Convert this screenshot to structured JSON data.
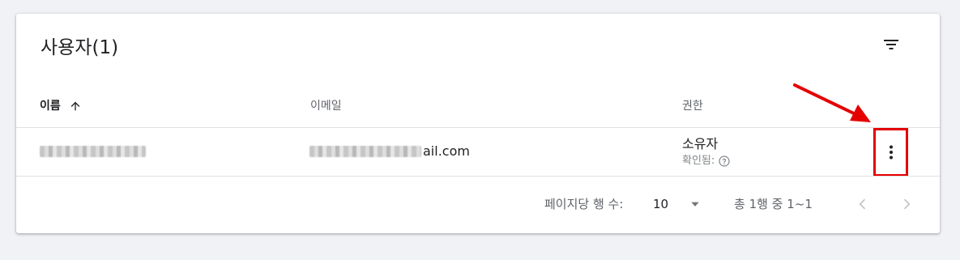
{
  "header": {
    "title": "사용자(1)"
  },
  "table": {
    "columns": {
      "name": "이름",
      "email": "이메일",
      "role": "권한"
    },
    "rows": [
      {
        "email_visible": "ail.com",
        "role": "소유자",
        "status": "확인됨:"
      }
    ]
  },
  "footer": {
    "rows_per_page_label": "페이지당 행 수:",
    "rows_per_page_value": "10",
    "range_text": "총 1행 중 1~1"
  },
  "icons": {
    "filter": "filter-icon",
    "sort": "arrow-up-icon",
    "more": "more-vert-icon",
    "help": "help-circle-icon",
    "dropdown": "caret-down-icon",
    "prev": "chevron-left-icon",
    "next": "chevron-right-icon"
  },
  "colors": {
    "annotation": "#e50000",
    "background": "#f0f2f6"
  }
}
